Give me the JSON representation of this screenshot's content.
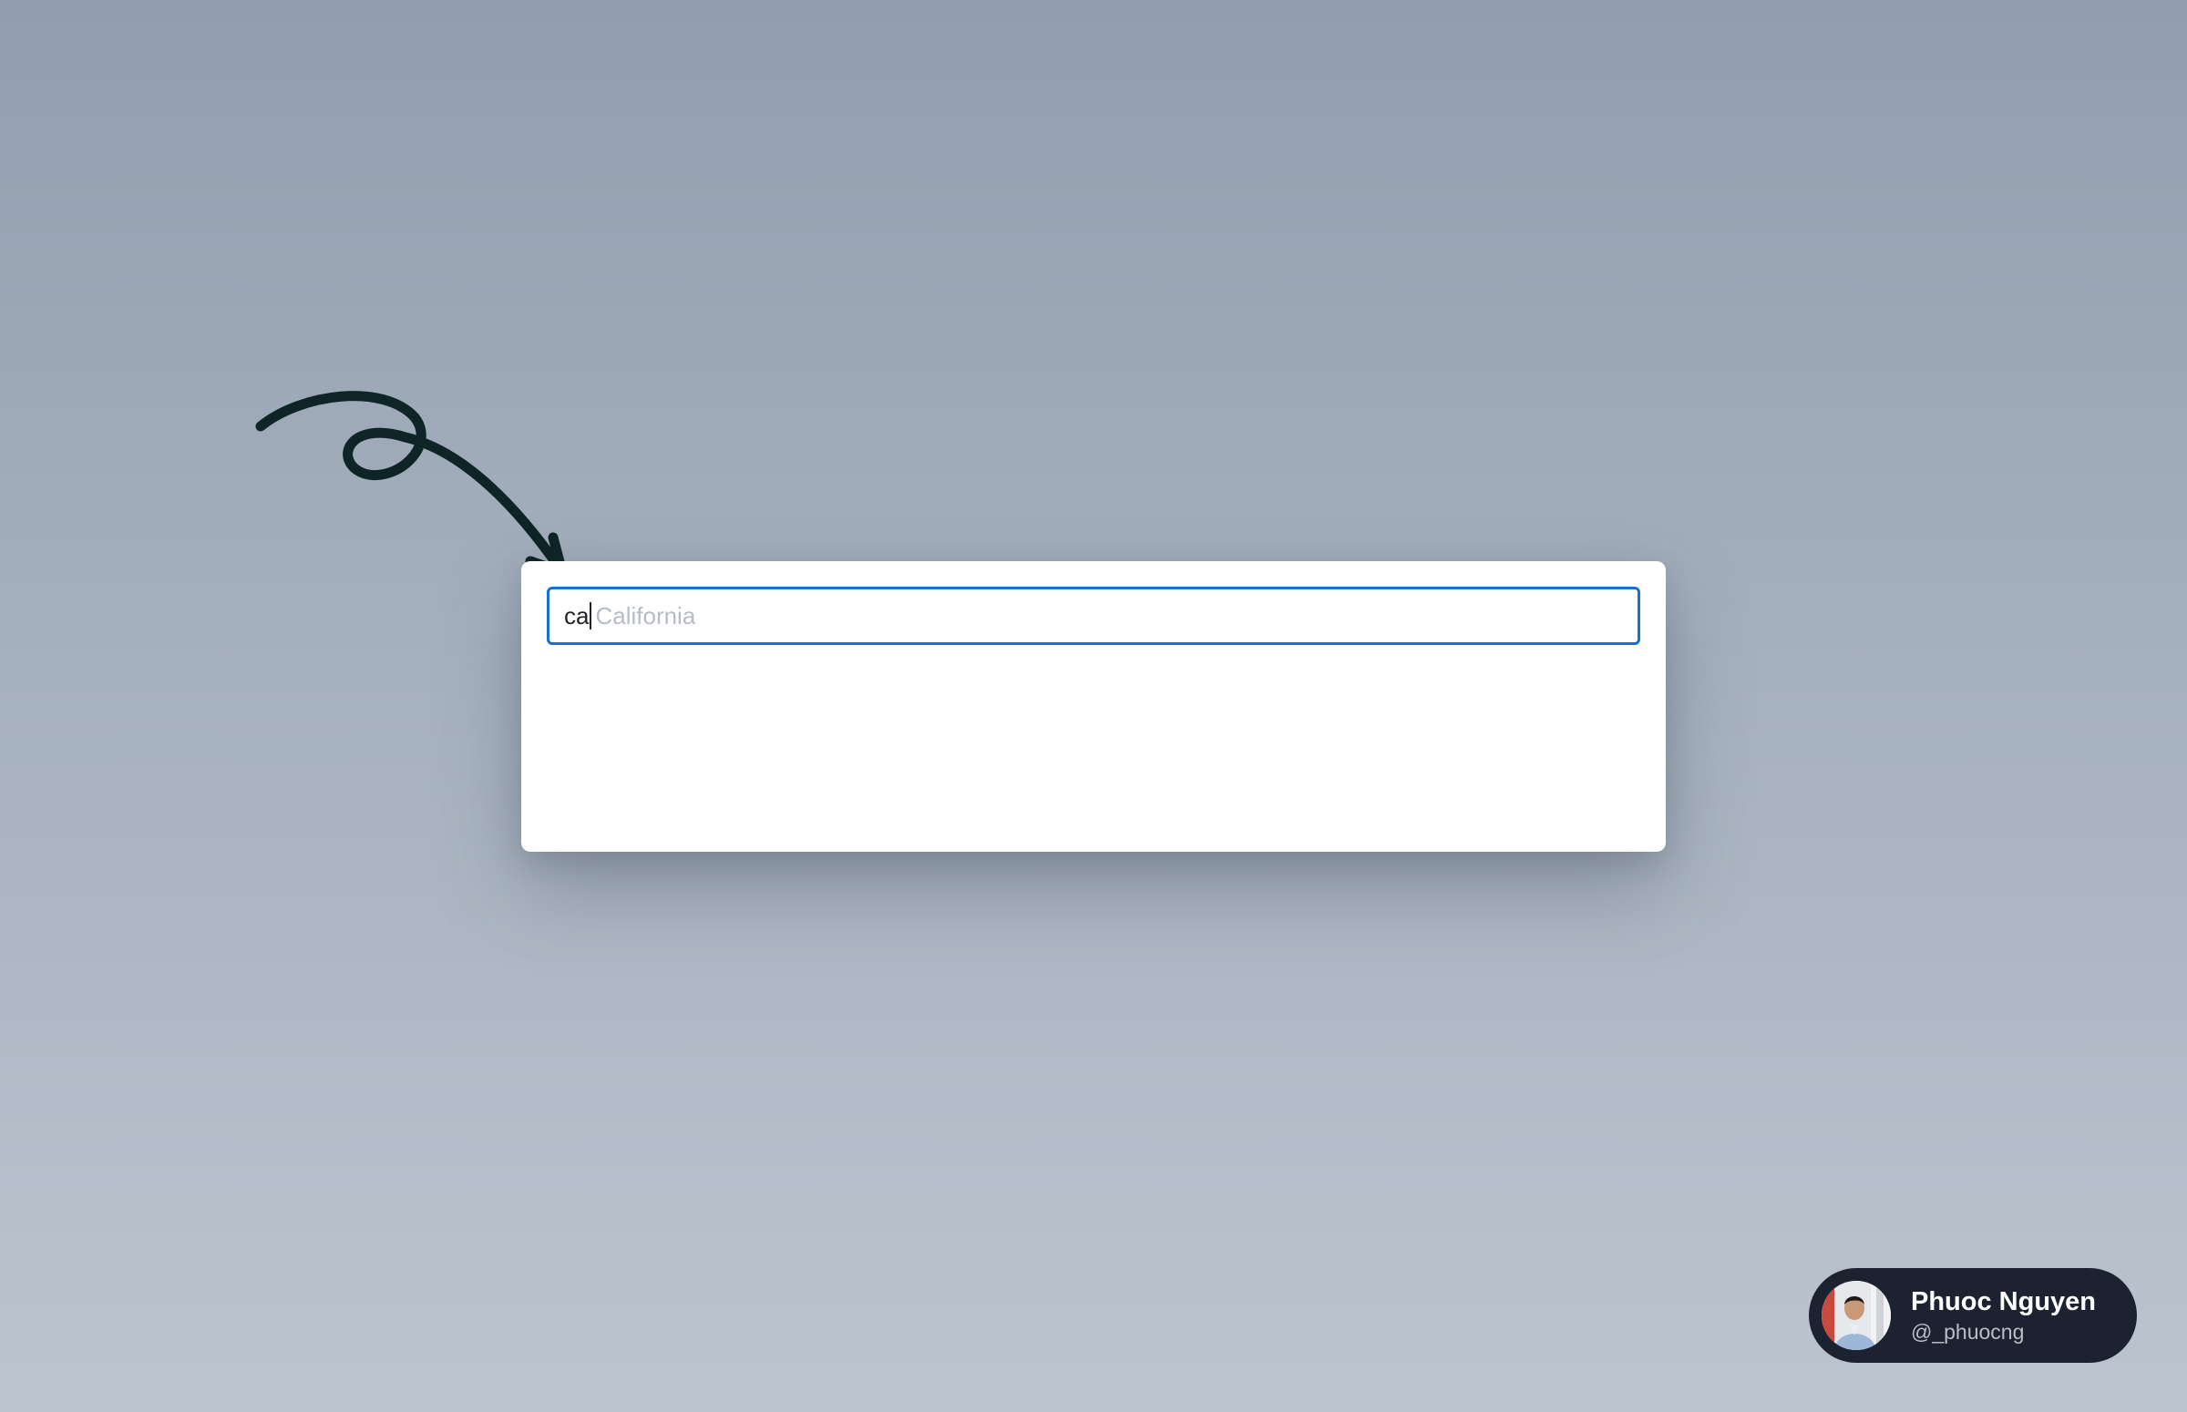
{
  "autocomplete": {
    "typed_value": "ca",
    "suggestion_completion": "California"
  },
  "profile": {
    "name": "Phuoc Nguyen",
    "handle": "@_phuocng"
  },
  "colors": {
    "input_border": "#1a6fd0",
    "suggestion_text": "#b7bcc4",
    "profile_background": "#1c2230",
    "arrow": "#0e2426"
  },
  "icons": {
    "arrow": "hand-drawn-loop-arrow",
    "avatar": "profile-photo"
  }
}
